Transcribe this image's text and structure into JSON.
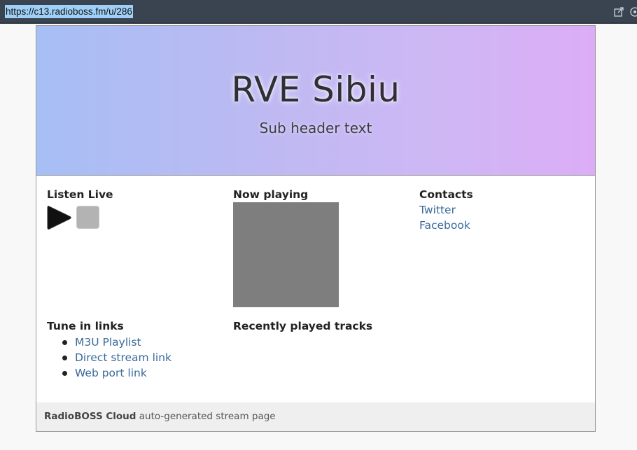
{
  "browser": {
    "url": "https://c13.radioboss.fm/u/286",
    "icons": [
      "share-icon",
      "extension-icon"
    ]
  },
  "hero": {
    "title": "RVE Sibiu",
    "subtitle": "Sub header text",
    "gradient": [
      "#a6bff5",
      "#dcadf6"
    ]
  },
  "listen": {
    "heading": "Listen Live",
    "play_icon": "play-icon",
    "stop_icon": "stop-icon"
  },
  "now_playing": {
    "heading": "Now playing"
  },
  "contacts": {
    "heading": "Contacts",
    "links": [
      {
        "label": "Twitter"
      },
      {
        "label": "Facebook"
      }
    ]
  },
  "tune_in": {
    "heading": "Tune in links",
    "links": [
      {
        "label": "M3U Playlist"
      },
      {
        "label": "Direct stream link"
      },
      {
        "label": "Web port link"
      }
    ]
  },
  "recent": {
    "heading": "Recently played tracks"
  },
  "footer": {
    "brand": "RadioBOSS Cloud",
    "text": "auto-generated stream page"
  },
  "colors": {
    "link": "#3a6a9a",
    "cover_placeholder": "#7e7e7e",
    "footer_bg": "#efefef"
  }
}
